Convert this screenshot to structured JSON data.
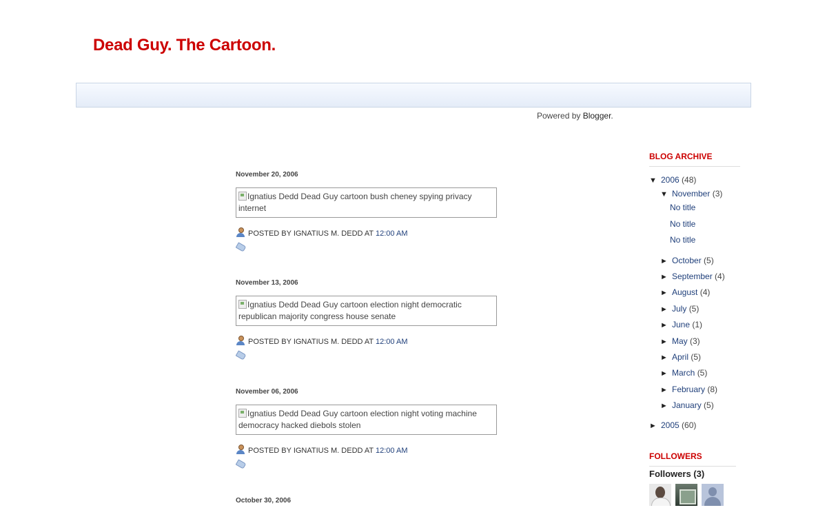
{
  "blog": {
    "title": "Dead Guy. The Cartoon."
  },
  "powered": {
    "prefix": "Powered by ",
    "link": "Blogger",
    "suffix": "."
  },
  "posts": [
    {
      "date": "November 20, 2006",
      "image_alt": "Ignatius Dedd Dead Guy cartoon bush cheney spying privacy internet",
      "posted_by": "POSTED BY IGNATIUS M. DEDD AT",
      "time": "12:00 AM"
    },
    {
      "date": "November 13, 2006",
      "image_alt": "Ignatius Dedd Dead Guy cartoon election night democratic republican majority congress house senate",
      "posted_by": "POSTED BY IGNATIUS M. DEDD AT",
      "time": "12:00 AM"
    },
    {
      "date": "November 06, 2006",
      "image_alt": "Ignatius Dedd Dead Guy cartoon election night voting machine democracy hacked diebols stolen",
      "posted_by": "POSTED BY IGNATIUS M. DEDD AT",
      "time": "12:00 AM"
    },
    {
      "date": "October 30, 2006"
    }
  ],
  "archive": {
    "title": "BLOG ARCHIVE",
    "year_2006": {
      "toggle": "▼",
      "label": "2006",
      "count": "(48)"
    },
    "november": {
      "toggle": "▼",
      "label": "November",
      "count": "(3)"
    },
    "november_posts": [
      "No title",
      "No title",
      "No title"
    ],
    "months": [
      {
        "toggle": "►",
        "label": "October",
        "count": "(5)"
      },
      {
        "toggle": "►",
        "label": "September",
        "count": "(4)"
      },
      {
        "toggle": "►",
        "label": "August",
        "count": "(4)"
      },
      {
        "toggle": "►",
        "label": "July",
        "count": "(5)"
      },
      {
        "toggle": "►",
        "label": "June",
        "count": "(1)"
      },
      {
        "toggle": "►",
        "label": "May",
        "count": "(3)"
      },
      {
        "toggle": "►",
        "label": "April",
        "count": "(5)"
      },
      {
        "toggle": "►",
        "label": "March",
        "count": "(5)"
      },
      {
        "toggle": "►",
        "label": "February",
        "count": "(8)"
      },
      {
        "toggle": "►",
        "label": "January",
        "count": "(5)"
      }
    ],
    "year_2005": {
      "toggle": "►",
      "label": "2005",
      "count": "(60)"
    }
  },
  "followers": {
    "title": "FOLLOWERS",
    "count_label": "Followers (3)"
  },
  "colors": {
    "title_red": "#cc0000",
    "link_blue": "#1f3f7a"
  }
}
